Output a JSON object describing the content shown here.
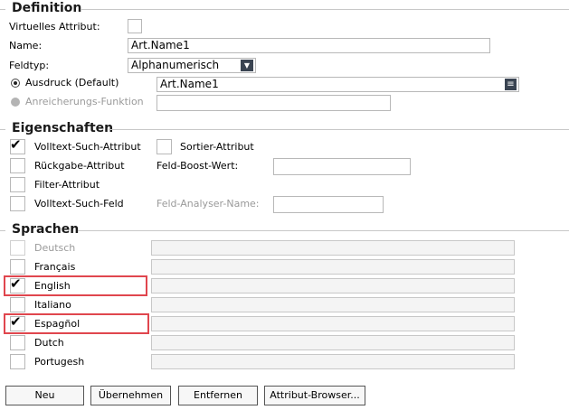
{
  "definition": {
    "title": "Definition",
    "virtual_label": "Virtuelles Attribut:",
    "name_label": "Name:",
    "name_value": "Art.Name1",
    "feldtyp_label": "Feldtyp:",
    "feldtyp_value": "Alphanumerisch",
    "ausdruck_label": "Ausdruck (Default)",
    "ausdruck_value": "Art.Name1",
    "anreicherung_label": "Anreicherungs-Funktion",
    "anreicherung_value": ""
  },
  "eigenschaften": {
    "title": "Eigenschaften",
    "volltext_such_attribut": "Volltext-Such-Attribut",
    "sortier_attribut": "Sortier-Attribut",
    "rueckgabe_attribut": "Rückgabe-Attribut",
    "feld_boost_label": "Feld-Boost-Wert:",
    "feld_boost_value": "",
    "filter_attribut": "Filter-Attribut",
    "volltext_such_feld": "Volltext-Such-Feld",
    "feld_analyser_label": "Feld-Analyser-Name:",
    "feld_analyser_value": ""
  },
  "sprachen": {
    "title": "Sprachen",
    "items": [
      {
        "label": "Deutsch",
        "checked": false,
        "disabled": true,
        "value": ""
      },
      {
        "label": "Français",
        "checked": false,
        "disabled": false,
        "value": ""
      },
      {
        "label": "English",
        "checked": true,
        "disabled": false,
        "value": ""
      },
      {
        "label": "Italiano",
        "checked": false,
        "disabled": false,
        "value": ""
      },
      {
        "label": "Espagñol",
        "checked": true,
        "disabled": false,
        "value": ""
      },
      {
        "label": "Dutch",
        "checked": false,
        "disabled": false,
        "value": ""
      },
      {
        "label": "Portugesh",
        "checked": false,
        "disabled": false,
        "value": ""
      }
    ]
  },
  "buttons": {
    "neu": "Neu",
    "uebernehmen": "Übernehmen",
    "entfernen": "Entfernen",
    "attribut_browser": "Attribut-Browser..."
  },
  "icons": {
    "check": "✔",
    "dropdown": "▼",
    "list_menu": "≡"
  },
  "colors": {
    "highlight": "#e0464e",
    "disabled_text": "#9a9a9a"
  }
}
